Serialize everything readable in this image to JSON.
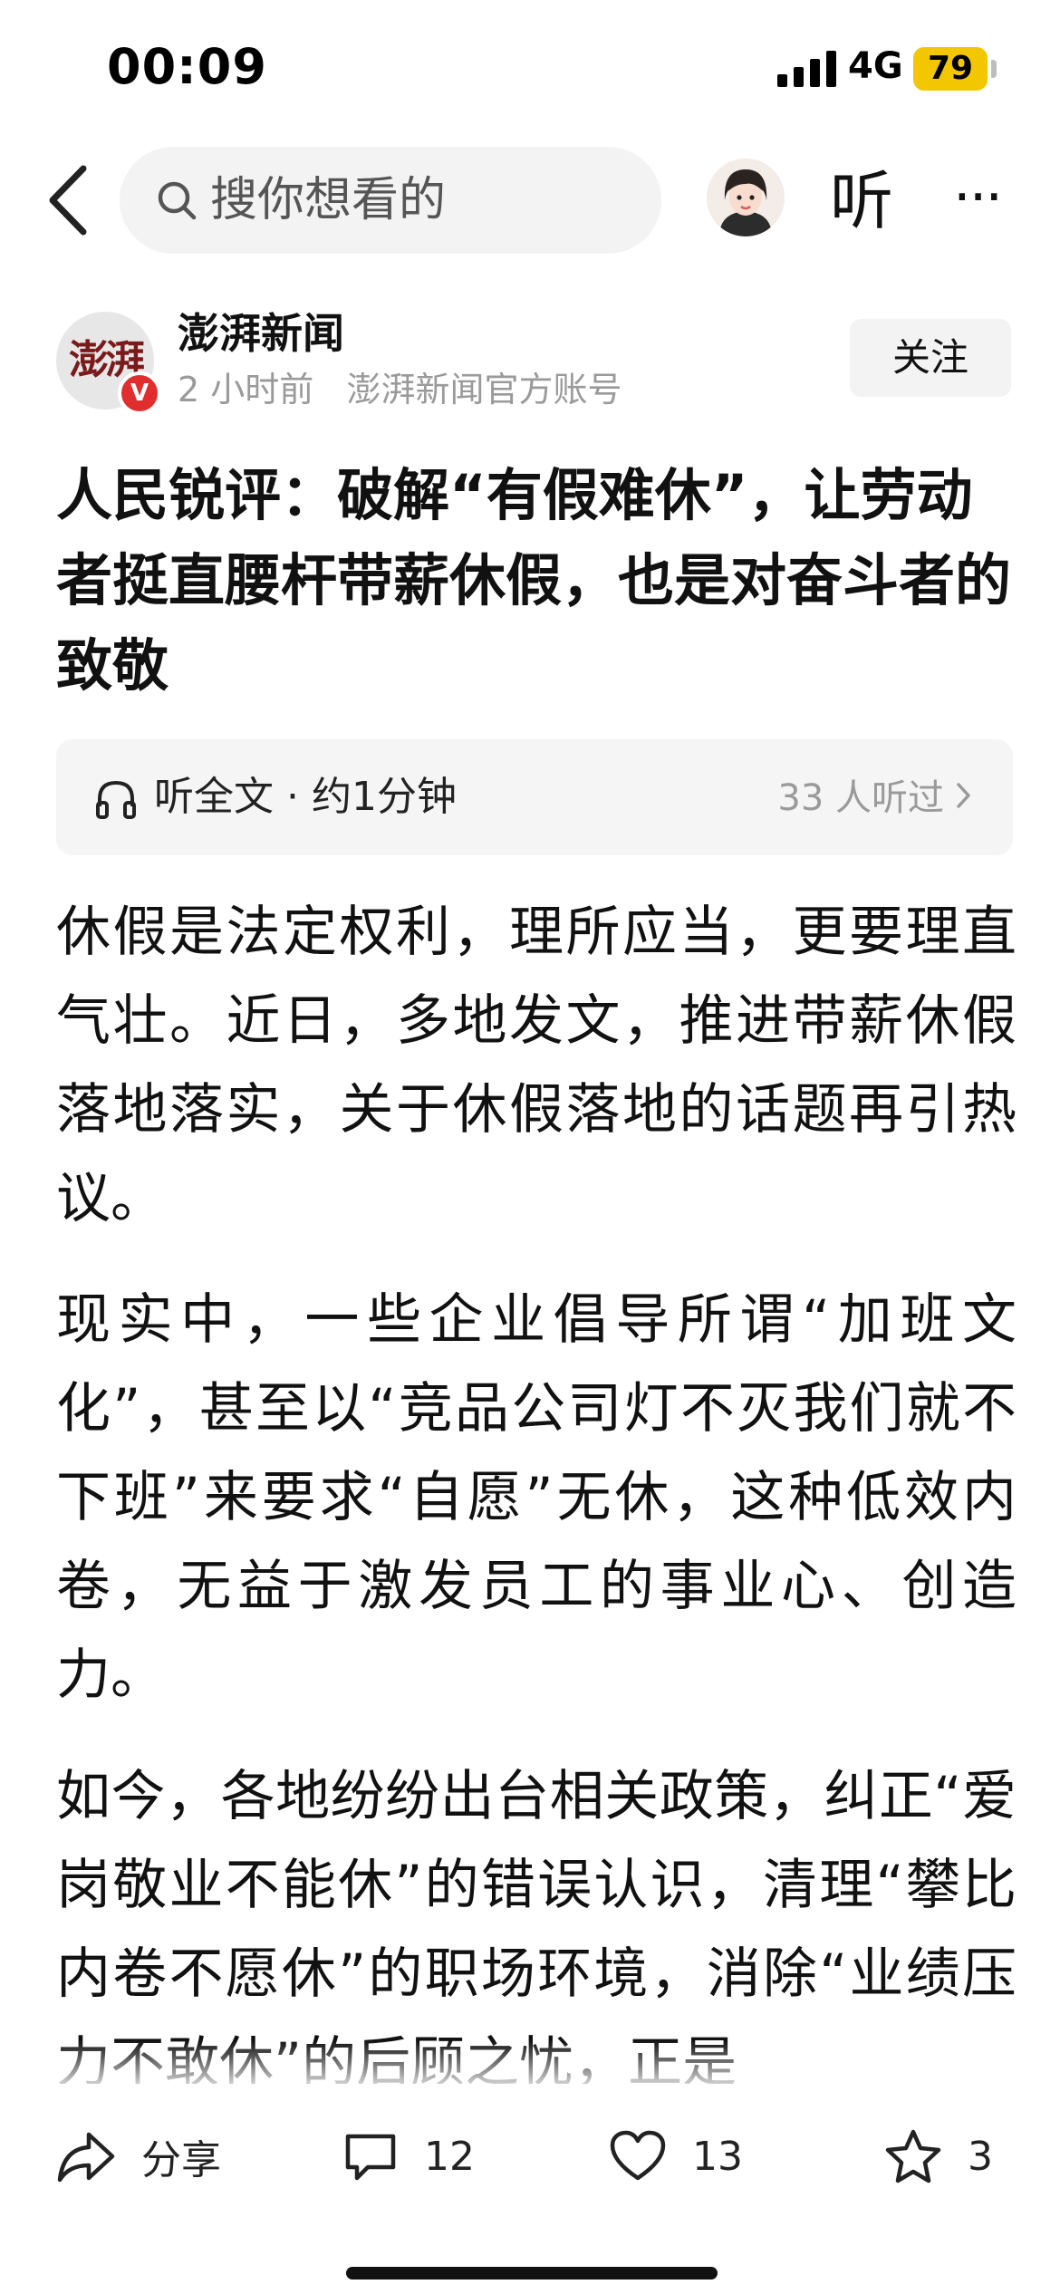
{
  "status_bar": {
    "time": "00:09",
    "network": "4G",
    "battery": "79",
    "battery_color": "#f2c600"
  },
  "nav": {
    "search_placeholder": "搜你想看的",
    "listen_label": "听",
    "more_label": "···"
  },
  "author": {
    "logo_text": "澎湃",
    "verified_badge": "V",
    "name": "澎湃新闻",
    "meta": "2 小时前   澎湃新闻官方账号",
    "follow_label": "关注"
  },
  "article": {
    "title": "人民锐评：破解“有假难休”，让劳动者挺直腰杆带薪休假，也是对奋斗者的致敬",
    "listen_bar": {
      "label": "听全文 · 约1分钟",
      "count": "33 人听过"
    },
    "paragraphs": [
      "休假是法定权利，理所应当，更要理直气壮。近日，多地发文，推进带薪休假落地落实，关于休假落地的话题再引热议。",
      "现实中，一些企业倡导所谓“加班文化”，甚至以“竞品公司灯不灭我们就不下班”来要求“自愿”无休，这种低效内卷，无益于激发员工的事业心、创造力。",
      "如今，各地纷纷出台相关政策，纠正“爱岗敬业不能休”的错误认识，清理“攀比内卷不愿休”的职场环境，消除“业绩压力不敢休”的后顾之忧，正是"
    ]
  },
  "actions": {
    "share_label": "分享",
    "comment_count": "12",
    "like_count": "13",
    "favorite_count": "3"
  }
}
